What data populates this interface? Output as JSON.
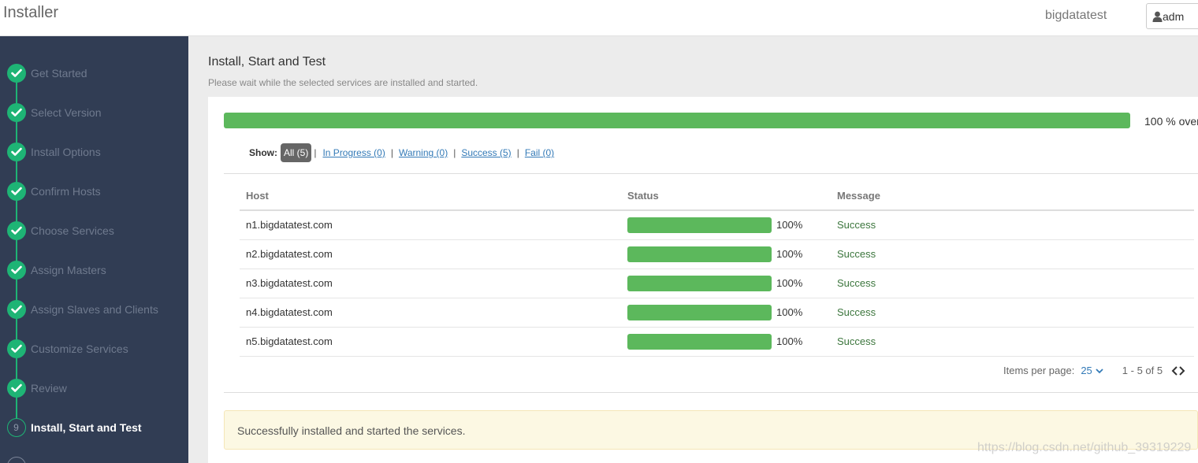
{
  "header": {
    "app_title": "Installer",
    "cluster_name": "bigdatatest",
    "user_button": "adm",
    "user_icon": "user-icon"
  },
  "sidebar": {
    "steps": [
      {
        "label": "Get Started",
        "state": "done"
      },
      {
        "label": "Select Version",
        "state": "done"
      },
      {
        "label": "Install Options",
        "state": "done"
      },
      {
        "label": "Confirm Hosts",
        "state": "done"
      },
      {
        "label": "Choose Services",
        "state": "done"
      },
      {
        "label": "Assign Masters",
        "state": "done"
      },
      {
        "label": "Assign Slaves and Clients",
        "state": "done"
      },
      {
        "label": "Customize Services",
        "state": "done"
      },
      {
        "label": "Review",
        "state": "done"
      },
      {
        "label": "Install, Start and Test",
        "state": "current",
        "number": "9"
      }
    ]
  },
  "main": {
    "title": "Install, Start and Test",
    "subtitle": "Please wait while the selected services are installed and started.",
    "overall_progress": 100,
    "overall_label": "100 % over",
    "filters": {
      "show_label": "Show:",
      "all": "All (5)",
      "in_progress": "In Progress (0)",
      "warning": "Warning (0)",
      "success": "Success (5)",
      "fail": "Fail (0)"
    },
    "table": {
      "columns": [
        "Host",
        "Status",
        "Message"
      ],
      "rows": [
        {
          "host": "n1.bigdatatest.com",
          "progress": 100,
          "pct": "100%",
          "message": "Success"
        },
        {
          "host": "n2.bigdatatest.com",
          "progress": 100,
          "pct": "100%",
          "message": "Success"
        },
        {
          "host": "n3.bigdatatest.com",
          "progress": 100,
          "pct": "100%",
          "message": "Success"
        },
        {
          "host": "n4.bigdatatest.com",
          "progress": 100,
          "pct": "100%",
          "message": "Success"
        },
        {
          "host": "n5.bigdatatest.com",
          "progress": 100,
          "pct": "100%",
          "message": "Success"
        }
      ]
    },
    "pager": {
      "items_label": "Items per page:",
      "per_page": "25",
      "range": "1 - 5 of 5"
    },
    "alert": "Successfully installed and started the services."
  },
  "watermark": "https://blog.csdn.net/github_39319229",
  "colors": {
    "accent_green": "#1eb475",
    "progress_green": "#5cb85c",
    "sidebar_bg": "#313d54",
    "link_blue": "#337ab7",
    "alert_bg": "#fcf8e3"
  }
}
